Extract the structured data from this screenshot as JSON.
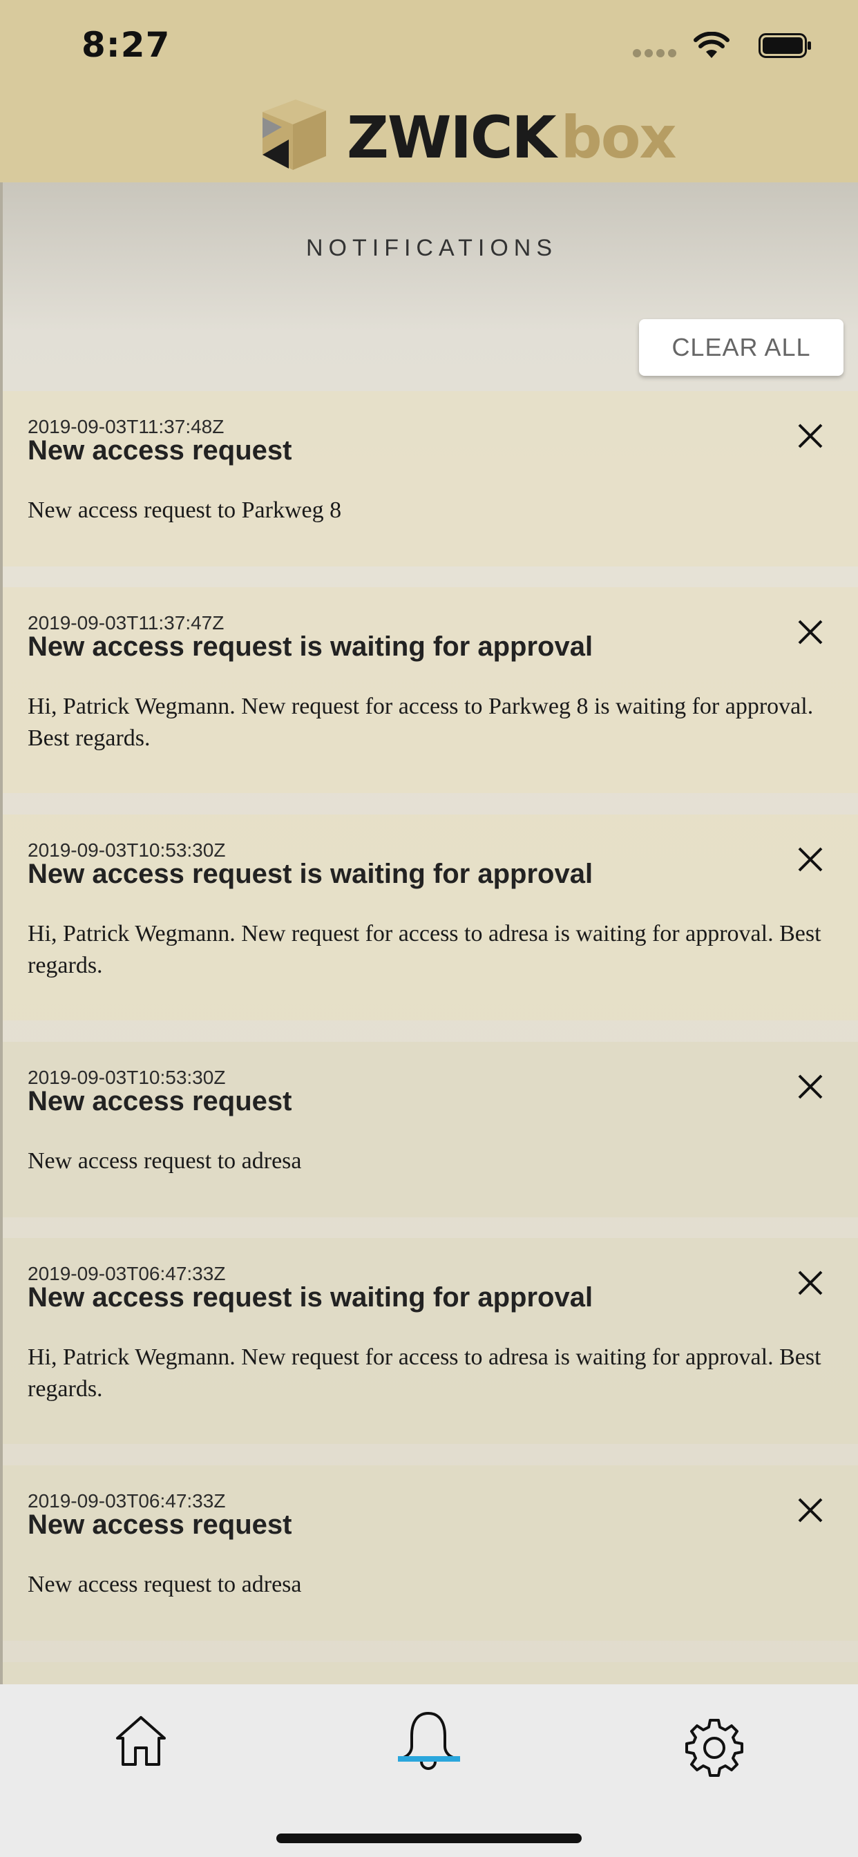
{
  "status_bar": {
    "time": "8:27"
  },
  "brand": {
    "name_part1": "ZWICK",
    "name_part2": "box",
    "accent_color": "#b69d63"
  },
  "page": {
    "title": "NOTIFICATIONS",
    "clear_all_label": "CLEAR ALL"
  },
  "notifications": [
    {
      "date": "2019-09-03T11:37:48Z",
      "title": "New access request",
      "body": "New access request to Parkweg 8"
    },
    {
      "date": "2019-09-03T11:37:47Z",
      "title": "New access request is waiting for approval",
      "body": "Hi, Patrick Wegmann. New request for access to Parkweg 8 is waiting for approval. Best regards."
    },
    {
      "date": "2019-09-03T10:53:30Z",
      "title": "New access request is waiting for approval",
      "body": "Hi, Patrick Wegmann. New request for access to adresa is waiting for approval. Best regards."
    },
    {
      "date": "2019-09-03T10:53:30Z",
      "title": "New access request",
      "body": "New access request to adresa"
    },
    {
      "date": "2019-09-03T06:47:33Z",
      "title": "New access request is waiting for approval",
      "body": "Hi, Patrick Wegmann. New request for access to adresa is waiting for approval. Best regards."
    },
    {
      "date": "2019-09-03T06:47:33Z",
      "title": "New access request",
      "body": "New access request to adresa"
    }
  ],
  "tabbar": {
    "items": [
      {
        "icon": "home-icon",
        "active": false
      },
      {
        "icon": "bell-icon",
        "active": true
      },
      {
        "icon": "gear-icon",
        "active": false
      }
    ],
    "active_color": "#2aa6dc"
  }
}
